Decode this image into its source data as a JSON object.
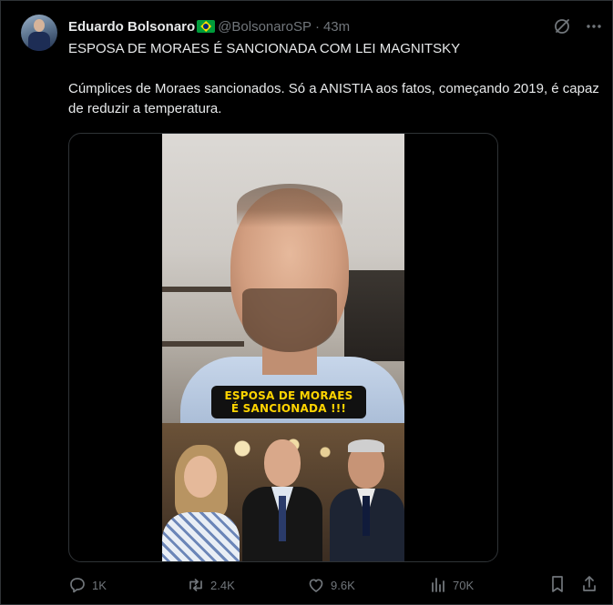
{
  "tweet": {
    "author_name": "Eduardo Bolsonaro",
    "author_handle": "@BolsonaroSP",
    "separator": "·",
    "time": "43m",
    "text_line1": "ESPOSA DE MORAES É SANCIONADA COM LEI MAGNITSKY",
    "text_line2": "Cúmplices de Moraes sancionados. Só a ANISTIA aos fatos, começando 2019, é capaz de reduzir a temperatura."
  },
  "media": {
    "caption_line1": "ESPOSA DE MORAES",
    "caption_line2": "É SANCIONADA !!!"
  },
  "actions": {
    "replies": "1K",
    "retweets": "2.4K",
    "likes": "9.6K",
    "views": "70K"
  },
  "icons": {
    "flag": "brazil-flag-icon",
    "grok": "grok-icon",
    "more": "more-icon",
    "reply": "reply-icon",
    "retweet": "retweet-icon",
    "like": "heart-icon",
    "views": "views-icon",
    "bookmark": "bookmark-icon",
    "share": "share-icon"
  },
  "colors": {
    "background": "#000000",
    "text": "#e7e9ea",
    "muted": "#71767b",
    "border": "#2f3336",
    "caption_text": "#ffd400",
    "flag_green": "#009c3b",
    "flag_yellow": "#ffdf00",
    "flag_blue": "#002776"
  }
}
